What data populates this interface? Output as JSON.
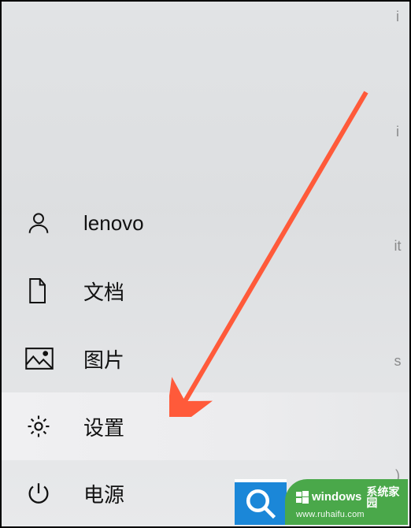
{
  "start_menu": {
    "items": [
      {
        "icon": "user-icon",
        "label": "lenovo"
      },
      {
        "icon": "document-icon",
        "label": "文档"
      },
      {
        "icon": "pictures-icon",
        "label": "图片"
      },
      {
        "icon": "settings-icon",
        "label": "设置",
        "highlighted": true
      },
      {
        "icon": "power-icon",
        "label": "电源"
      }
    ]
  },
  "right_strip": {
    "fragments": [
      "i",
      "i",
      "it",
      "s",
      ")"
    ]
  },
  "search_tile": {
    "icon": "search-icon"
  },
  "watermark": {
    "brand_prefix": "windows",
    "brand_suffix_zh": "系统家园",
    "url": "www.ruhaifu.com"
  },
  "annotation": {
    "arrow_color": "#ff5a3a"
  }
}
